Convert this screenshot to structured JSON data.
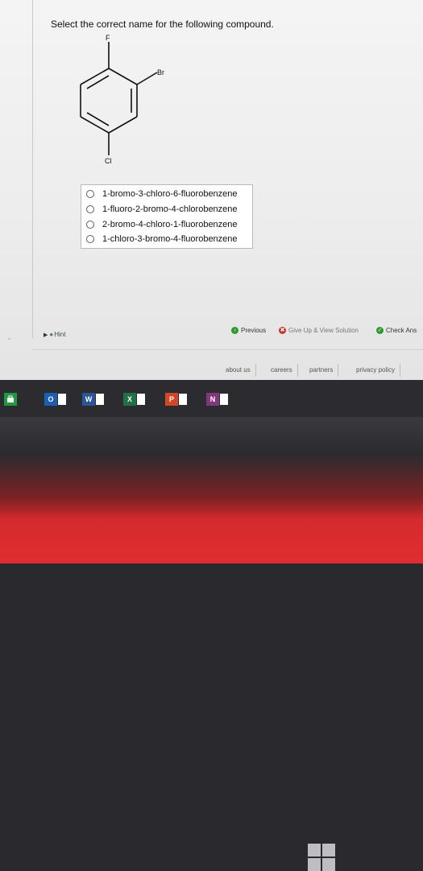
{
  "question": "Select the correct name for the following compound.",
  "molecule": {
    "substituent_top": "F",
    "substituent_right": "Br",
    "substituent_bottom": "Cl"
  },
  "choices": [
    "1-bromo-3-chloro-6-fluorobenzene",
    "1-fluoro-2-bromo-4-chlorobenzene",
    "2-bromo-4-chloro-1-fluorobenzene",
    "1-chloro-3-bromo-4-fluorobenzene"
  ],
  "controls": {
    "hint": "Hint",
    "previous": "Previous",
    "give_up": "Give Up & View Solution",
    "check_answer": "Check Ans"
  },
  "footer": {
    "about": "about us",
    "careers": "careers",
    "partners": "partners",
    "privacy": "privacy policy"
  },
  "taskbar": {
    "store_icon": "store-icon",
    "outlook_label": "O",
    "word_label": "W",
    "excel_label": "X",
    "powerpoint_label": "P",
    "onenote_label": "N"
  }
}
